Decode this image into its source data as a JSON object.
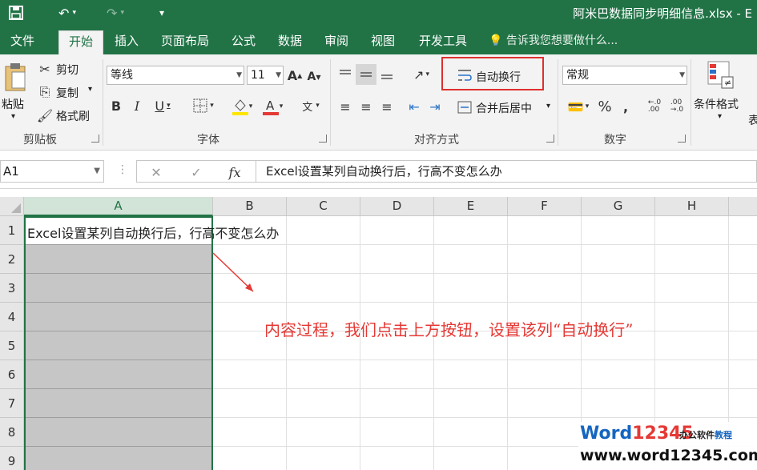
{
  "app": {
    "title": "阿米巴数据同步明细信息.xlsx - E",
    "accent": "#217346"
  },
  "qat": {
    "save_icon": "save-icon",
    "undo_icon": "undo-icon",
    "redo_icon": "redo-icon",
    "customize_icon": "customize-icon"
  },
  "tabs": [
    {
      "label": "文件"
    },
    {
      "label": "开始"
    },
    {
      "label": "插入"
    },
    {
      "label": "页面布局"
    },
    {
      "label": "公式"
    },
    {
      "label": "数据"
    },
    {
      "label": "审阅"
    },
    {
      "label": "视图"
    },
    {
      "label": "开发工具"
    }
  ],
  "tellme": "告诉我您想要做什么...",
  "ribbon": {
    "clipboard": {
      "paste": "粘贴",
      "cut": "剪切",
      "copy": "复制",
      "format_painter": "格式刷",
      "group": "剪贴板"
    },
    "font": {
      "name": "等线",
      "size": "11",
      "group": "字体"
    },
    "alignment": {
      "wrap_text": "自动换行",
      "merge_center": "合并后居中",
      "group": "对齐方式"
    },
    "number": {
      "format": "常规",
      "group": "数字"
    },
    "styles": {
      "conditional": "条件格式",
      "cut_text": "表"
    }
  },
  "formula_bar": {
    "name_box": "A1",
    "fx": "fx",
    "content": "Excel设置某列自动换行后，行高不变怎么办"
  },
  "columns": [
    "A",
    "B",
    "C",
    "D",
    "E",
    "F",
    "G",
    "H"
  ],
  "rows": [
    "1",
    "2",
    "3",
    "4",
    "5",
    "6",
    "7",
    "8",
    "9"
  ],
  "cell_a1": "Excel设置某列自动换行后，行高不变怎么办",
  "annotation": "内容过程，我们点击上方按钮，设置该列“自动换行”",
  "watermark": {
    "brand_word": "Word",
    "brand_digits": "12345",
    "brand_sub_1": "办公软件",
    "brand_sub_2": "教程",
    "url": "www.word12345.com"
  }
}
